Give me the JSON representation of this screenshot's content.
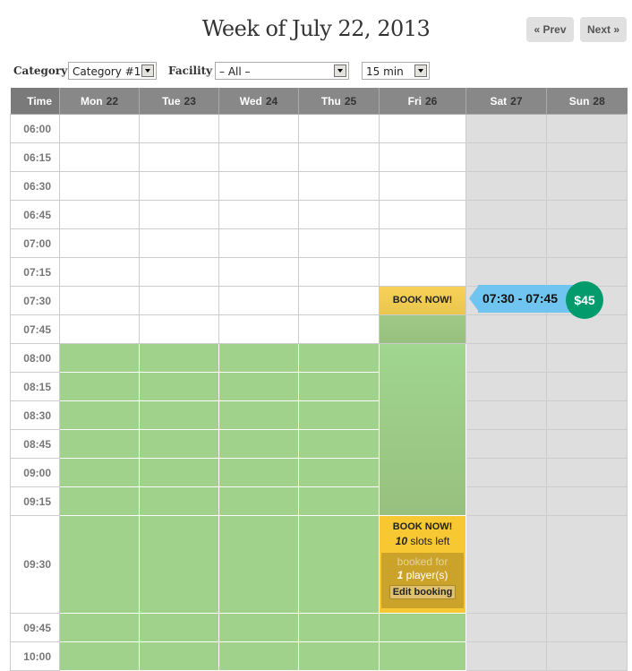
{
  "header": {
    "title": "Week of July 22, 2013",
    "prev_label": "« Prev",
    "next_label": "Next »"
  },
  "filters": {
    "category_label": "Category",
    "category_value": "Category #1",
    "facility_label": "Facility",
    "facility_value": "– All –",
    "interval_value": "15 min"
  },
  "grid": {
    "time_header": "Time",
    "days": [
      {
        "name": "Mon",
        "date": "22"
      },
      {
        "name": "Tue",
        "date": "23"
      },
      {
        "name": "Wed",
        "date": "24"
      },
      {
        "name": "Thu",
        "date": "25"
      },
      {
        "name": "Fri",
        "date": "26"
      },
      {
        "name": "Sat",
        "date": "27"
      },
      {
        "name": "Sun",
        "date": "28"
      }
    ],
    "times": [
      "06:00",
      "06:15",
      "06:30",
      "06:45",
      "07:00",
      "07:15",
      "07:30",
      "07:45",
      "08:00",
      "08:15",
      "08:30",
      "08:45",
      "09:00",
      "09:15",
      "09:30",
      "09:45",
      "10:00"
    ]
  },
  "slot_0730_fri": {
    "label": "BOOK NOW!"
  },
  "tooltip": {
    "range": "07:30 - 07:45",
    "price": "$45"
  },
  "booking_0930_fri": {
    "title": "BOOK NOW!",
    "slots_count": "10",
    "slots_text": " slots left",
    "booked_for": "booked for",
    "players_count": "1",
    "players_text": " player(s)",
    "edit_label": "Edit booking"
  },
  "colors": {
    "available": "#a0d28c",
    "book_now": "#f7c831",
    "tooltip": "#6fc5f0",
    "price_badge": "#039a6c",
    "weekend": "#dedede",
    "header": "#888888"
  }
}
